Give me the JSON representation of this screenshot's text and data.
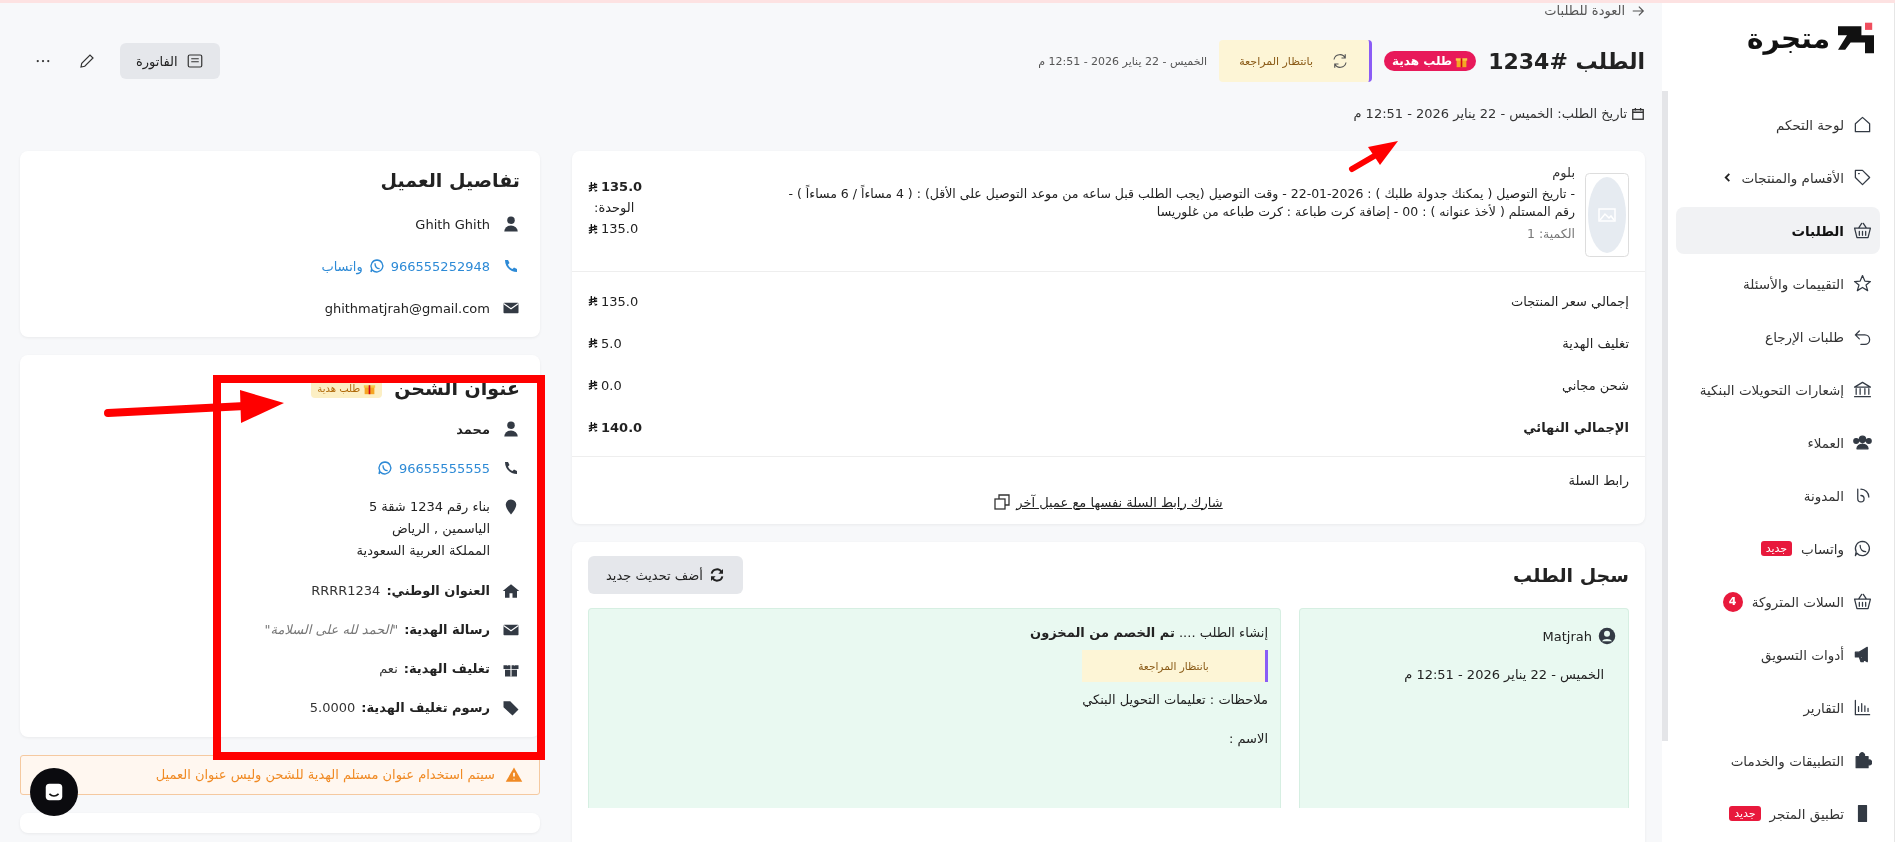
{
  "sidebar": {
    "logo": "متجرة",
    "items": [
      {
        "label": "لوحة التحكم",
        "selected": false
      },
      {
        "label": "الأقسام والمنتجات",
        "selected": false,
        "expandable": true
      },
      {
        "label": "الطلبات",
        "selected": true
      },
      {
        "label": "التقييمات والأسئلة",
        "selected": false
      },
      {
        "label": "طلبات الإرجاع",
        "selected": false
      },
      {
        "label": "إشعارات التحويلات البنكية",
        "selected": false
      },
      {
        "label": "العملاء",
        "selected": false
      },
      {
        "label": "المدونة",
        "selected": false
      },
      {
        "label": "واتساب",
        "selected": false,
        "badge": "جديد"
      },
      {
        "label": "السلات المتروكة",
        "selected": false,
        "count": "4"
      },
      {
        "label": "أدوات التسويق",
        "selected": false
      },
      {
        "label": "التقارير",
        "selected": false
      },
      {
        "label": "التطبيقات والخدمات",
        "selected": false
      },
      {
        "label": "تطبيق المتجر",
        "selected": false,
        "badge": "جديد"
      }
    ]
  },
  "back_link": "العودة للطلبات",
  "header": {
    "title": "الطلب #1234",
    "gift_badge": {
      "text": "طلب هدية",
      "kind": "strong"
    },
    "status": "بانتظار المراجعة",
    "status_date": "الخميس - 22 يناير 2026 - 12:51 م",
    "invoice_button": "الفاتورة",
    "order_date": "تاريخ الطلب: الخميس - 22 يناير 2026 - 12:51 م"
  },
  "product": {
    "name": "بلوم",
    "description": "- تاريخ التوصيل ( يمكنك جدولة طلبك ) : 2026-01-22 - وقت التوصيل (يجب الطلب قبل ساعه من موعد التوصيل على الأقل) : ( 4 مساءاً / 6 مساءاً ) - رقم المستلم ( لأخذ عنوانه ) : 00 - إضافة كرت طباعة : كرت طباعه من غلوريسا",
    "quantity": "الكمية: 1",
    "price": "135.0",
    "unit_label": "الوحدة:",
    "unit_price": "135.0"
  },
  "totals": [
    {
      "label": "إجمالي سعر المنتجات",
      "value": "135.0",
      "bold": false
    },
    {
      "label": "تغليف الهدية",
      "value": "5.0",
      "bold": false
    },
    {
      "label": "شحن مجاني",
      "value": "0.0",
      "bold": false
    },
    {
      "label": "الإجمالي النهائي",
      "value": "140.0",
      "bold": true
    }
  ],
  "cart_link": {
    "label": "رابط السلة",
    "link": "شارك رابط السلة نفسها مع عميل آخر"
  },
  "history": {
    "title": "سجل الطلب",
    "add_button": "أضف تحديث جديد",
    "entries": [
      {
        "actor": "Matjrah",
        "date": "الخميس - 22 يناير 2026 - 12:51 م",
        "message": "إنشاء الطلب .... **تم الخصم من المخزون**",
        "status": "بانتظار المراجعة",
        "notes": "ملاحظات : تعليمات التحويل البنكي",
        "name_label": "الاسم :"
      }
    ]
  },
  "customer": {
    "title": "تفاصيل العميل",
    "name": "Ghith Ghith",
    "phone": "966555252948",
    "whatsapp": "واتساب",
    "email": "ghithmatjrah@gmail.com"
  },
  "shipping": {
    "title": "عنوان الشحن",
    "gift_badge": {
      "text": "طلب هدية",
      "kind": "soft"
    },
    "name": "محمد",
    "phone": "96655555555",
    "address": [
      "بناء رقم 1234 شقة 5",
      "الياسمين , الرياض",
      "المملكة العربية السعودية"
    ],
    "fields": [
      {
        "label": "العنوان الوطني:",
        "value": "RRRR1234",
        "italic": false
      },
      {
        "label": "رسالة الهدية:",
        "value": "\"الحمد لله على السلامة\"",
        "italic": true
      },
      {
        "label": "تغليف الهدية:",
        "value": "نعم",
        "italic": false
      },
      {
        "label": "رسوم تغليف الهدية:",
        "value": "5.0000",
        "italic": false
      }
    ]
  },
  "warning": "سيتم استخدام عنوان مستلم الهدية للشحن وليس عنوان العميل"
}
